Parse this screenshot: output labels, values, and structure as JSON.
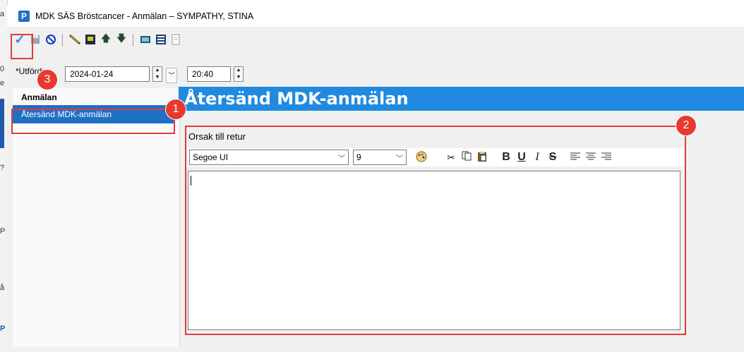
{
  "window": {
    "title": "MDK SÄS Bröstcancer - Anmälan – SYMPATHY, STINA",
    "icon_letter": "P",
    "accent_color": "#1f6fc5"
  },
  "toolbar": {
    "icons": [
      "check-icon",
      "save-icon",
      "cancel-icon",
      "pen-icon",
      "edit-icon",
      "arrow-up-icon",
      "arrow-down-icon",
      "keyboard-icon",
      "list-icon",
      "document-icon"
    ]
  },
  "date_row": {
    "label": "*Utförd:",
    "date": "2024-01-24",
    "time": "20:40"
  },
  "nav": {
    "header": "Anmälan",
    "selected_item": "Återsänd MDK-anmälan"
  },
  "main": {
    "heading": "Återsänd MDK-anmälan",
    "heading_color": "#1f8ae0",
    "reason_label": "Orsak till retur",
    "font_name": "Segoe UI",
    "font_size": "9",
    "format_buttons": {
      "bold": "B",
      "underline": "U",
      "italic": "I",
      "strike": "S"
    },
    "text_value": ""
  },
  "callouts": {
    "color": "#e23b3b",
    "one": "1",
    "two": "2",
    "three": "3"
  },
  "left_strip_chars": [
    "a",
    "0",
    "e",
    "?",
    "P",
    "å",
    "P"
  ]
}
